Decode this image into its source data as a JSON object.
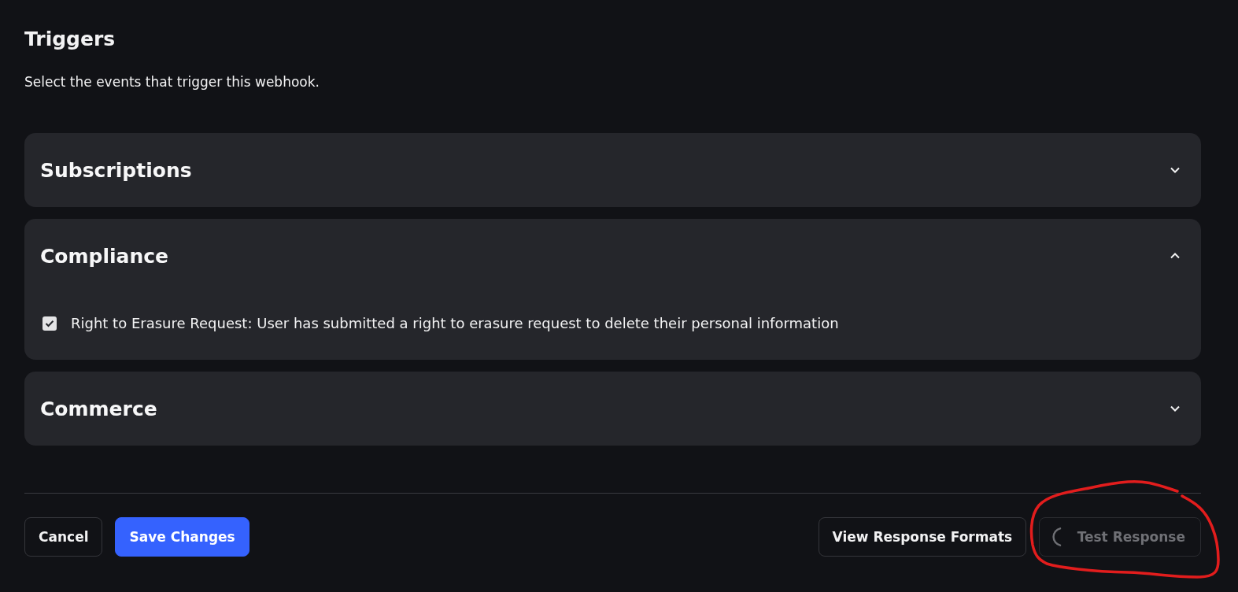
{
  "heading": {
    "title": "Triggers",
    "description": "Select the events that trigger this webhook."
  },
  "sections": [
    {
      "title": "Subscriptions",
      "expanded": false
    },
    {
      "title": "Compliance",
      "expanded": true,
      "events": [
        {
          "label": "Right to Erasure Request: User has submitted a right to erasure request to delete their personal information",
          "checked": true
        }
      ]
    },
    {
      "title": "Commerce",
      "expanded": false
    }
  ],
  "footer": {
    "left_buttons": [
      {
        "label": "Cancel",
        "kind": "secondary",
        "disabled": false,
        "loading": false
      },
      {
        "label": "Save Changes",
        "kind": "primary",
        "disabled": false,
        "loading": false
      }
    ],
    "right_buttons": [
      {
        "label": "View Response Formats",
        "kind": "secondary",
        "disabled": false,
        "loading": false
      },
      {
        "label": "Test Response",
        "kind": "secondary",
        "disabled": true,
        "loading": true
      }
    ]
  },
  "annotations": [
    {
      "kind": "freehand-circle"
    }
  ]
}
